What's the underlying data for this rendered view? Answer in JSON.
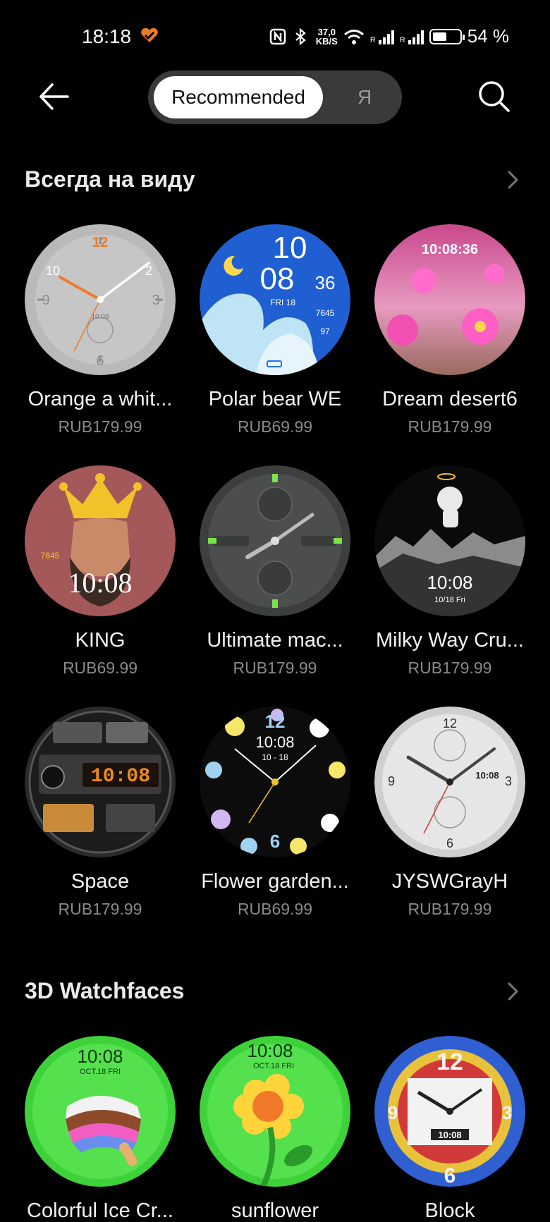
{
  "status_bar": {
    "time": "18:18",
    "net_speed_value": "37,0",
    "net_speed_unit": "KB/S",
    "battery": "54 %",
    "battery_level": 0.54,
    "signal_label_1": "R",
    "signal_label_2": "R"
  },
  "nav": {
    "tab_recommended": "Recommended",
    "tab_me": "Я"
  },
  "sections": [
    {
      "title": "Всегда на виду",
      "items": [
        {
          "name": "Orange a whit...",
          "price": "RUB179.99"
        },
        {
          "name": "Polar bear WE",
          "price": "RUB69.99"
        },
        {
          "name": "Dream desert6",
          "price": "RUB179.99"
        },
        {
          "name": "KING",
          "price": "RUB69.99"
        },
        {
          "name": "Ultimate mac...",
          "price": "RUB179.99"
        },
        {
          "name": "Milky Way Cru...",
          "price": "RUB179.99"
        },
        {
          "name": "Space",
          "price": "RUB179.99"
        },
        {
          "name": "Flower garden...",
          "price": "RUB69.99"
        },
        {
          "name": "JYSWGrayH",
          "price": "RUB179.99"
        }
      ]
    },
    {
      "title": "3D Watchfaces",
      "items": [
        {
          "name": "Colorful Ice Cr...",
          "price": ""
        },
        {
          "name": "sunflower",
          "price": ""
        },
        {
          "name": "Block",
          "price": ""
        }
      ]
    }
  ],
  "dial_text": {
    "polar_hour": "10",
    "polar_min": "08",
    "polar_sec": "36",
    "polar_day": "FRI 18",
    "polar_steps": "7645",
    "polar_hr": "97",
    "desert_time": "10:08:36",
    "king_time": "10:08",
    "king_steps": "7645",
    "milky_time": "10:08",
    "milky_date": "10/18  Fri",
    "space_time": "10:08",
    "flower_time": "10:08",
    "flower_date": "10 - 18",
    "jysw_date": "10:08",
    "ice_time": "10:08",
    "ice_date": "OCT.18  FRI",
    "sun_time": "10:08",
    "sun_date": "OCT.18 FRI",
    "block_time": "10:08"
  },
  "colors": {
    "accent_orange": "#f07a2a",
    "background": "#000000",
    "segment_bg": "#3a3a3a",
    "price_gray": "#8a8a8a"
  }
}
